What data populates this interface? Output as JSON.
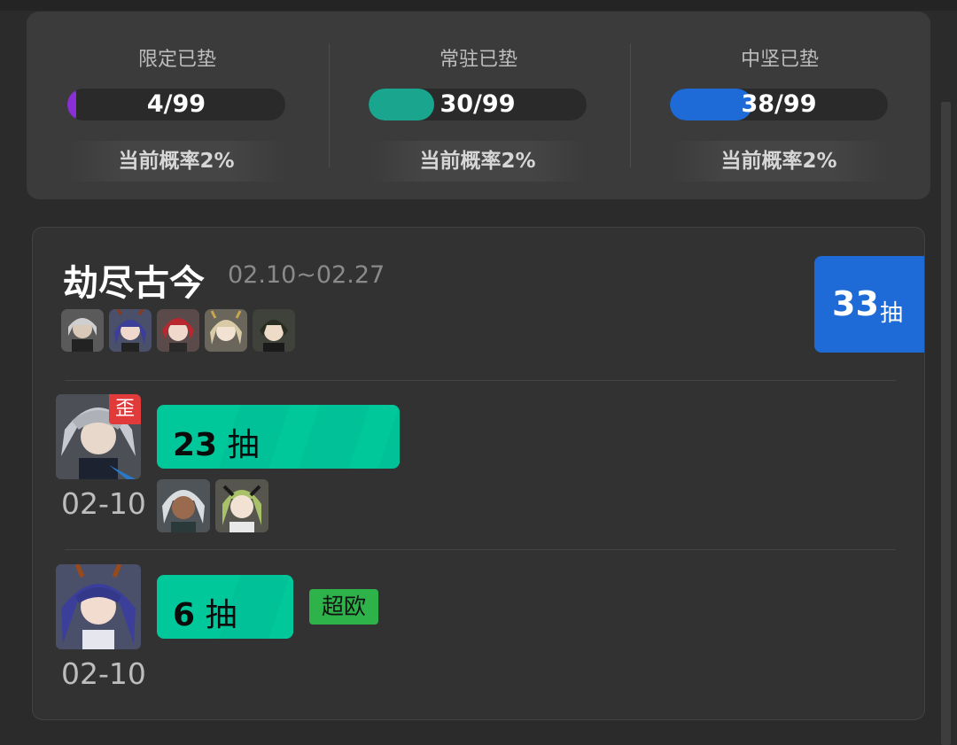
{
  "pity": [
    {
      "label": "限定已垫",
      "value_text": "4/99",
      "progress": 0.04,
      "color": "#8a2fd6",
      "rate": "当前概率2%"
    },
    {
      "label": "常驻已垫",
      "value_text": "30/99",
      "progress": 0.3,
      "color": "#1aa58e",
      "rate": "当前概率2%"
    },
    {
      "label": "中坚已垫",
      "value_text": "38/99",
      "progress": 0.38,
      "color": "#1e6ad6",
      "rate": "当前概率2%"
    }
  ],
  "banner": {
    "title": "劫尽古今",
    "date_range": "02.10~02.27",
    "total_pulls": "33",
    "total_unit": "抽",
    "featured_count": 5,
    "pulls": [
      {
        "pulls_text": "23",
        "unit": "抽",
        "date": "02-10",
        "offbanner_tag": "歪",
        "lucky_tag": "",
        "progress": 0.23,
        "extra_count": 2
      },
      {
        "pulls_text": "6",
        "unit": "抽",
        "date": "02-10",
        "offbanner_tag": "",
        "lucky_tag": "超欧",
        "progress": 0.06,
        "extra_count": 0
      }
    ]
  },
  "colors": {
    "accent_blue": "#1e6ad6",
    "pull_green": "#00c89a",
    "lucky_green": "#2db34a",
    "warn_red": "#e03a3a"
  }
}
